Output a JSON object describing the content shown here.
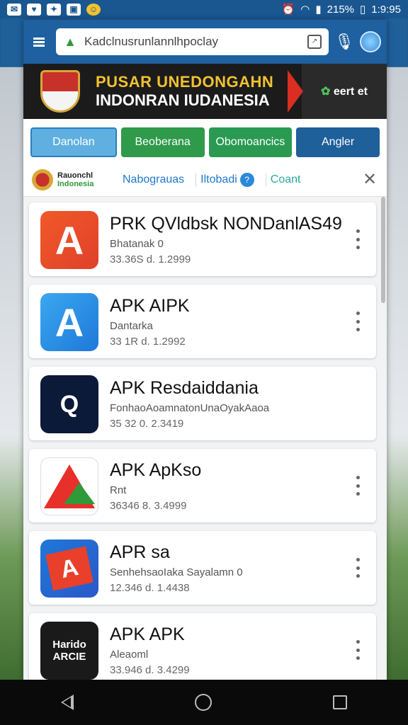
{
  "status_bar": {
    "icons_left": [
      "mail-icon",
      "twitter-icon",
      "game-icon",
      "photo-icon",
      "emoji-icon"
    ],
    "battery": "215%",
    "time": "1:9:95"
  },
  "browser": {
    "url": "Kadclnusrunlannlhpoclay"
  },
  "banner": {
    "line1": "PUSAR UNEDONGAHN",
    "line2": "INDONRAN IUDANESIA",
    "cta": "eert et"
  },
  "buttons": [
    "Danolan",
    "Beoberana",
    "Obomoancics",
    "Angler"
  ],
  "subnav": {
    "brand_line1": "Rauonchl",
    "brand_line2": "Indonesia",
    "links": [
      "Nabograuas",
      "Iltobadi",
      "Coant"
    ]
  },
  "apps": [
    {
      "title": "PRK QVldbsk NONDanlAS49",
      "subtitle": "Bhatanak           0",
      "meta": "33.36S  d.    1.2999",
      "icon_text": "A"
    },
    {
      "title": "APK AIPK",
      "subtitle": "Dantarka",
      "meta": "33 1R   d.    1.2992",
      "icon_text": "A"
    },
    {
      "title": "APK Resdaiddania",
      "subtitle": "FonhaoAoamnatonUnaOyakAaoa",
      "meta": "35 32   0.    2.3419",
      "icon_text": "Q"
    },
    {
      "title": "APK ApKso",
      "subtitle": "Rnt",
      "meta": "36346   8.    3.4999",
      "icon_text": ""
    },
    {
      "title": "APR sa",
      "subtitle": "SenhehsaoIaka  Sayalamn  0",
      "meta": "12.346   d.    1.4438",
      "icon_text": "A"
    },
    {
      "title": "APK APK",
      "subtitle": "Aleaoml",
      "meta": "33.946   d.    3.4299",
      "icon_text": "Harido ARCIE"
    }
  ]
}
